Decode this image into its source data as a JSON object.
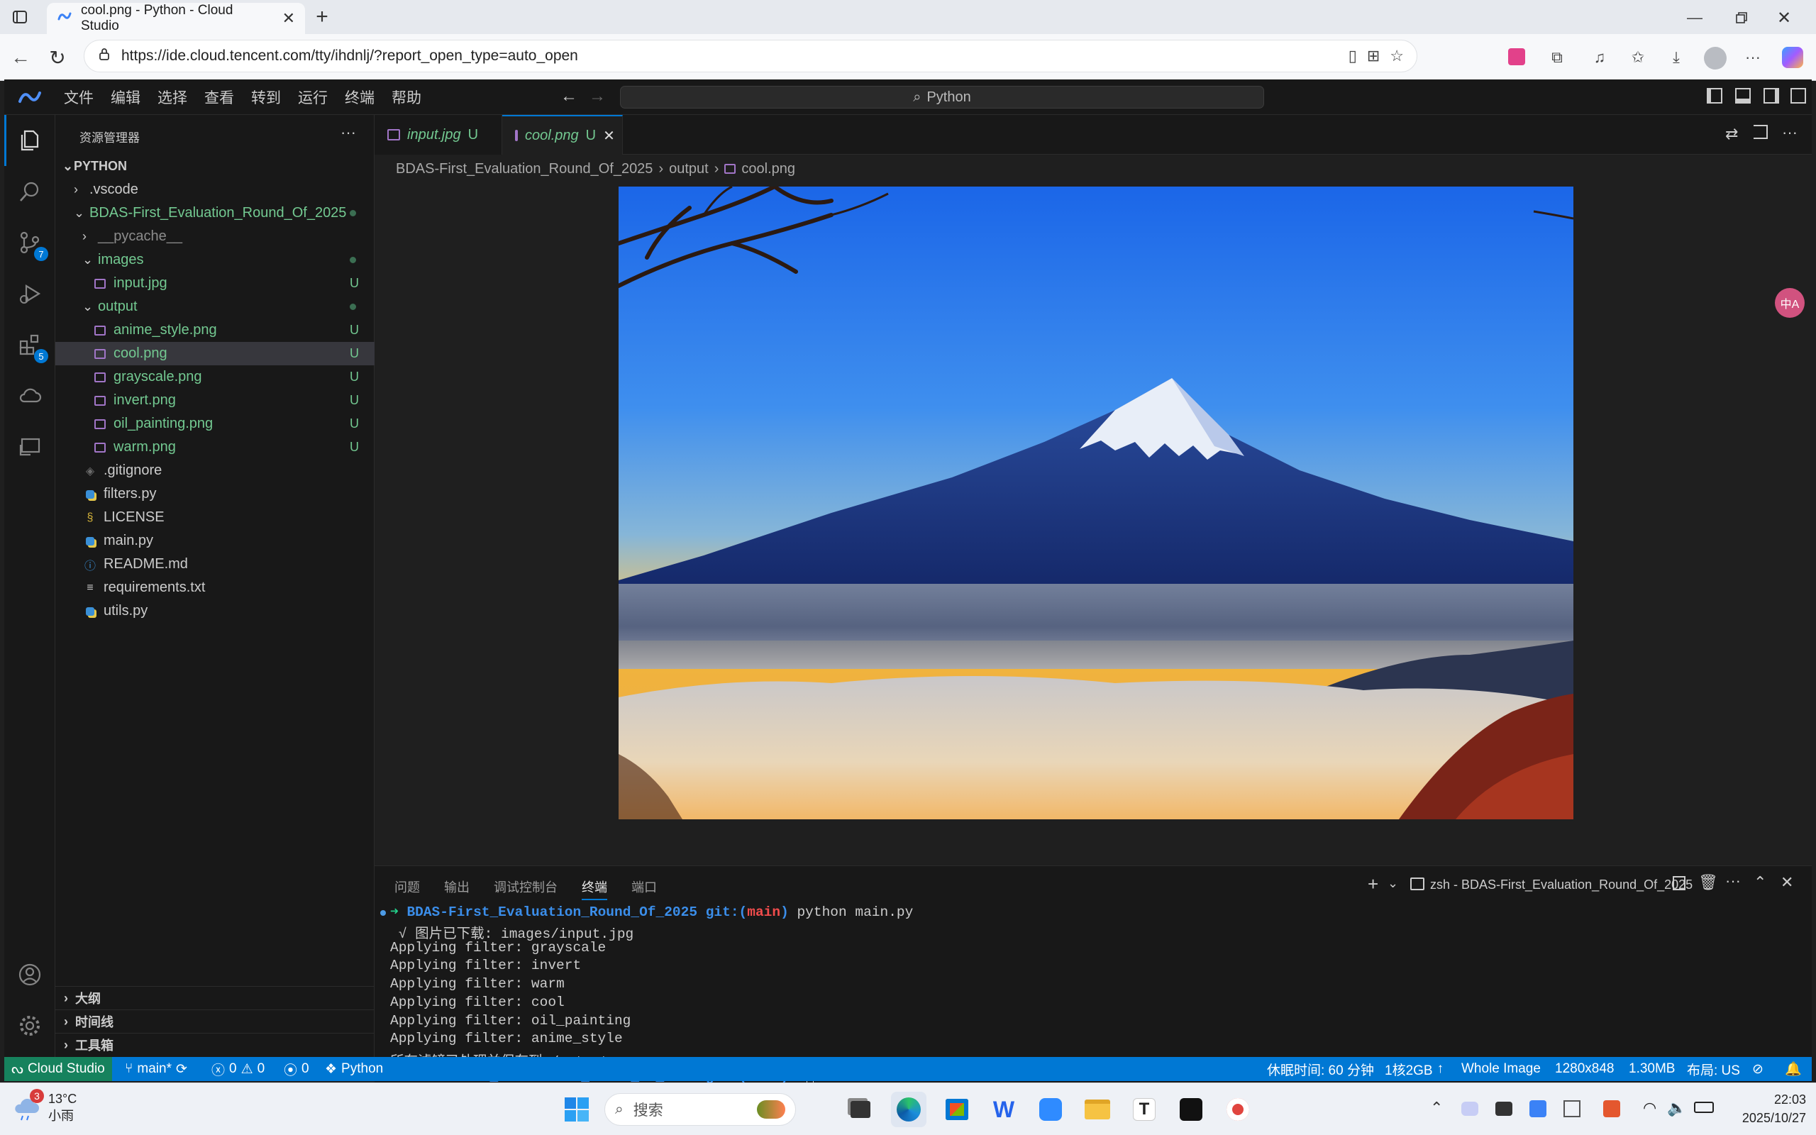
{
  "browser": {
    "tab_title": "cool.png - Python - Cloud Studio",
    "url": "https://ide.cloud.tencent.com/tty/ihdnlj/?report_open_type=auto_open"
  },
  "ide": {
    "menu": [
      "文件",
      "编辑",
      "选择",
      "查看",
      "转到",
      "运行",
      "终端",
      "帮助"
    ],
    "command_center": "Python",
    "explorer_title": "资源管理器",
    "root": "PYTHON",
    "tree": [
      {
        "label": ".vscode",
        "depth": 1,
        "type": "folder",
        "open": false,
        "status": "",
        "color": "#cccccc"
      },
      {
        "label": "BDAS-First_Evaluation_Round_Of_2025",
        "depth": 1,
        "type": "folder",
        "open": true,
        "status": "dot",
        "color": "#73c991"
      },
      {
        "label": "__pycache__",
        "depth": 2,
        "type": "folder",
        "open": false,
        "status": "",
        "color": "#8c8c8c"
      },
      {
        "label": "images",
        "depth": 2,
        "type": "folder",
        "open": true,
        "status": "dot",
        "color": "#73c991"
      },
      {
        "label": "input.jpg",
        "depth": 3,
        "type": "image",
        "status": "U",
        "color": "#73c991"
      },
      {
        "label": "output",
        "depth": 2,
        "type": "folder",
        "open": true,
        "status": "dot",
        "color": "#73c991"
      },
      {
        "label": "anime_style.png",
        "depth": 3,
        "type": "image",
        "status": "U",
        "color": "#73c991"
      },
      {
        "label": "cool.png",
        "depth": 3,
        "type": "image",
        "status": "U",
        "color": "#73c991",
        "selected": true
      },
      {
        "label": "grayscale.png",
        "depth": 3,
        "type": "image",
        "status": "U",
        "color": "#73c991"
      },
      {
        "label": "invert.png",
        "depth": 3,
        "type": "image",
        "status": "U",
        "color": "#73c991"
      },
      {
        "label": "oil_painting.png",
        "depth": 3,
        "type": "image",
        "status": "U",
        "color": "#73c991"
      },
      {
        "label": "warm.png",
        "depth": 3,
        "type": "image",
        "status": "U",
        "color": "#73c991"
      },
      {
        "label": ".gitignore",
        "depth": 2,
        "type": "git",
        "status": "",
        "color": "#cccccc"
      },
      {
        "label": "filters.py",
        "depth": 2,
        "type": "python",
        "status": "",
        "color": "#cccccc"
      },
      {
        "label": "LICENSE",
        "depth": 2,
        "type": "license",
        "status": "",
        "color": "#cccccc"
      },
      {
        "label": "main.py",
        "depth": 2,
        "type": "python",
        "status": "",
        "color": "#cccccc"
      },
      {
        "label": "README.md",
        "depth": 2,
        "type": "info",
        "status": "",
        "color": "#cccccc"
      },
      {
        "label": "requirements.txt",
        "depth": 2,
        "type": "text",
        "status": "",
        "color": "#cccccc"
      },
      {
        "label": "utils.py",
        "depth": 2,
        "type": "python",
        "status": "",
        "color": "#cccccc"
      }
    ],
    "sections": [
      "大纲",
      "时间线",
      "工具箱"
    ],
    "activity_badges": {
      "scm": "7",
      "extensions": "5"
    },
    "tabs": [
      {
        "label": "input.jpg",
        "status": "U",
        "active": false
      },
      {
        "label": "cool.png",
        "status": "U",
        "active": true
      }
    ],
    "breadcrumb": [
      "BDAS-First_Evaluation_Round_Of_2025",
      "output",
      "cool.png"
    ],
    "panel_tabs": [
      "问题",
      "输出",
      "调试控制台",
      "终端",
      "端口"
    ],
    "terminal_title": "zsh - BDAS-First_Evaluation_Round_Of_2025",
    "terminal": {
      "dir": "BDAS-First_Evaluation_Round_Of_2025",
      "git_open": "git:(",
      "branch": "main",
      "git_close": ")",
      "command": "python main.py",
      "x": "✗",
      "lines": [
        " √ 图片已下载: images/input.jpg",
        "Applying filter: grayscale",
        "Applying filter: invert",
        "Applying filter: warm",
        "Applying filter: cool",
        "Applying filter: oil_painting",
        "Applying filter: anime_style",
        "所有滤镜已处理并保存到./output"
      ]
    },
    "status": {
      "brand": "Cloud Studio",
      "branch": "main*",
      "errors": "0",
      "warnings": "0",
      "ports": "0",
      "language": "Python",
      "sleep": "休眠时间: 60 分钟",
      "resources": "1核2GB",
      "zoom": "Whole Image",
      "dims": "1280x848",
      "size": "1.30MB",
      "layout": "布局: US"
    }
  },
  "taskbar": {
    "weather_temp": "13°C",
    "weather_desc": "小雨",
    "weather_badge": "3",
    "search": "搜索",
    "time": "22:03",
    "date": "2025/10/27"
  }
}
